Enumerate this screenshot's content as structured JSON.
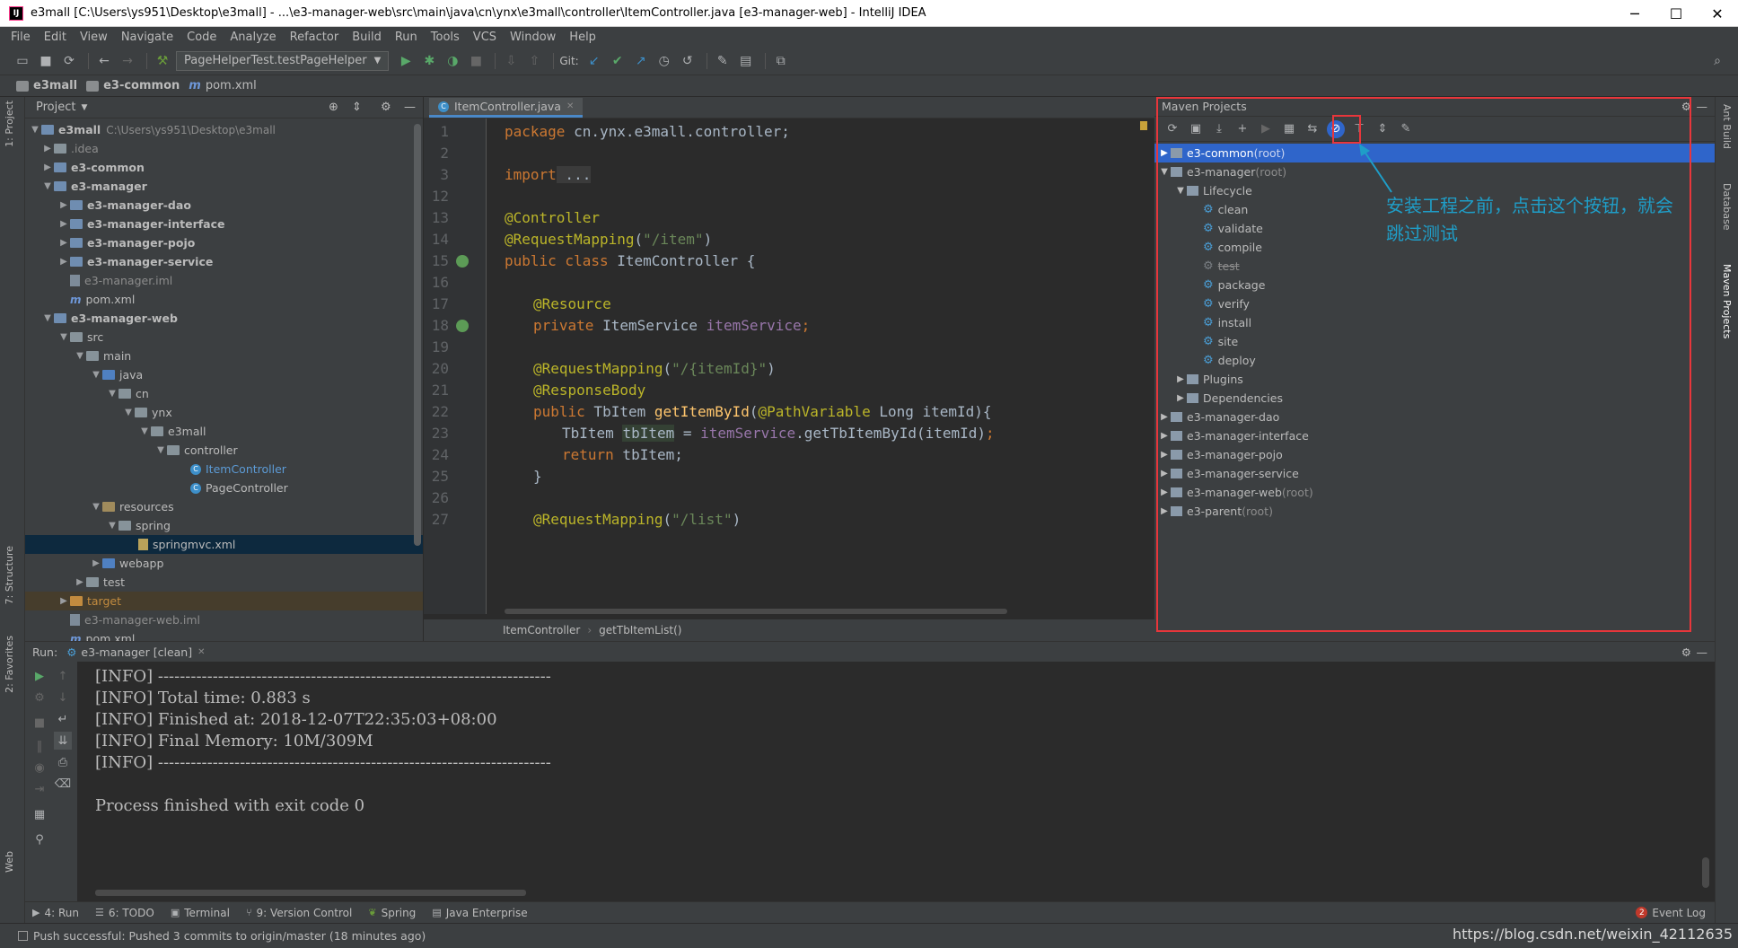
{
  "window": {
    "title": "e3mall [C:\\Users\\ys951\\Desktop\\e3mall] - ...\\e3-manager-web\\src\\main\\java\\cn\\ynx\\e3mall\\controller\\ItemController.java [e3-manager-web] - IntelliJ IDEA",
    "app_icon": "IJ",
    "minimize": "─",
    "maximize": "☐",
    "close": "✕"
  },
  "menu": [
    "File",
    "Edit",
    "View",
    "Navigate",
    "Code",
    "Analyze",
    "Refactor",
    "Build",
    "Run",
    "Tools",
    "VCS",
    "Window",
    "Help"
  ],
  "toolbar": {
    "run_config": "PageHelperTest.testPageHelper",
    "git_label": "Git:"
  },
  "navbar": {
    "crumbs": [
      "e3mall",
      "e3-common",
      "pom.xml"
    ]
  },
  "left_strip": {
    "project_tab": "1: Project",
    "structure_tab": "7: Structure",
    "favorites_tab": "2: Favorites",
    "web_tab": "Web"
  },
  "right_strip": {
    "ant_tab": "Ant Build",
    "database_tab": "Database",
    "maven_tab": "Maven Projects"
  },
  "project": {
    "header": "Project",
    "root": "e3mall",
    "root_path": "C:\\Users\\ys951\\Desktop\\e3mall",
    "idea": ".idea",
    "common": "e3-common",
    "manager": "e3-manager",
    "dao": "e3-manager-dao",
    "iface": "e3-manager-interface",
    "pojo": "e3-manager-pojo",
    "service": "e3-manager-service",
    "manager_iml": "e3-manager.iml",
    "manager_pom": "pom.xml",
    "web": "e3-manager-web",
    "src": "src",
    "main": "main",
    "java": "java",
    "cn": "cn",
    "ynx": "ynx",
    "e3mall": "e3mall",
    "controller": "controller",
    "item_controller": "ItemController",
    "page_controller": "PageController",
    "resources": "resources",
    "spring": "spring",
    "springmvc": "springmvc.xml",
    "webapp": "webapp",
    "test": "test",
    "target": "target",
    "web_iml": "e3-manager-web.iml",
    "web_pom": "pom.xml"
  },
  "editor": {
    "tab": "ItemController.java",
    "line_numbers": [
      "1",
      "2",
      "3",
      "12",
      "13",
      "14",
      "15",
      "16",
      "17",
      "18",
      "19",
      "20",
      "21",
      "22",
      "23",
      "24",
      "25",
      "26",
      "27"
    ],
    "code": {
      "l1_kw": "package",
      "l1_rest": " cn.ynx.e3mall.controller;",
      "l3_kw": "import",
      "l3_fold": " ...",
      "l13": "@Controller",
      "l14_an": "@RequestMapping",
      "l14_open": "(",
      "l14_str": "\"/item\"",
      "l14_close": ")",
      "l15_kw": "public class",
      "l15_rest": " ItemController {",
      "l17": "@Resource",
      "l18_kw": "private",
      "l18_type": " ItemService ",
      "l18_field": "itemService",
      "l18_end": ";",
      "l20_an": "@RequestMapping",
      "l20_open": "(",
      "l20_str": "\"/{itemId}\"",
      "l20_close": ")",
      "l21": "@ResponseBody",
      "l22_kw": "public",
      "l22_type": " TbItem ",
      "l22_fn": "getItemById",
      "l22_p1": "(",
      "l22_an": "@PathVariable",
      "l22_rest": " Long itemId){",
      "l23_type": "TbItem ",
      "l23_var": "tbItem",
      "l23_eq": " = ",
      "l23_field": "itemService",
      "l23_call": ".getTbItemById(itemId)",
      "l23_end": ";",
      "l24_kw": "return",
      "l24_rest": " tbItem;",
      "l25": "}",
      "l27_an": "@RequestMapping",
      "l27_open": "(",
      "l27_str": "\"/list\"",
      "l27_close": ")"
    },
    "crumbs": [
      "ItemController",
      "getTbItemList()"
    ]
  },
  "maven": {
    "header": "Maven Projects",
    "common": "e3-common",
    "common_suffix": " (root)",
    "manager": "e3-manager",
    "manager_suffix": " (root)",
    "lifecycle": "Lifecycle",
    "goals": [
      "clean",
      "validate",
      "compile",
      "test",
      "package",
      "verify",
      "install",
      "site",
      "deploy"
    ],
    "plugins": "Plugins",
    "dependencies": "Dependencies",
    "dao": "e3-manager-dao",
    "iface": "e3-manager-interface",
    "pojo": "e3-manager-pojo",
    "service": "e3-manager-service",
    "web": "e3-manager-web",
    "web_suffix": " (root)",
    "parent": "e3-parent",
    "parent_suffix": " (root)"
  },
  "annotation": {
    "line1": "安装工程之前，点击这个按钮，就会",
    "line2": "跳过测试"
  },
  "run": {
    "label": "Run:",
    "tab": "e3-manager [clean]",
    "console": [
      "[INFO] ------------------------------------------------------------------------",
      "[INFO] Total time: 0.883 s",
      "[INFO] Finished at: 2018-12-07T22:35:03+08:00",
      "[INFO] Final Memory: 10M/309M",
      "[INFO] ------------------------------------------------------------------------",
      "",
      "Process finished with exit code 0"
    ]
  },
  "bottom_tabs": [
    "4: Run",
    "6: TODO",
    "Terminal",
    "9: Version Control",
    "Spring",
    "Java Enterprise"
  ],
  "event_log": {
    "count": "2",
    "label": "Event Log"
  },
  "status": "Push successful: Pushed 3 commits to origin/master (18 minutes ago)",
  "watermark": "https://blog.csdn.net/weixin_42112635"
}
